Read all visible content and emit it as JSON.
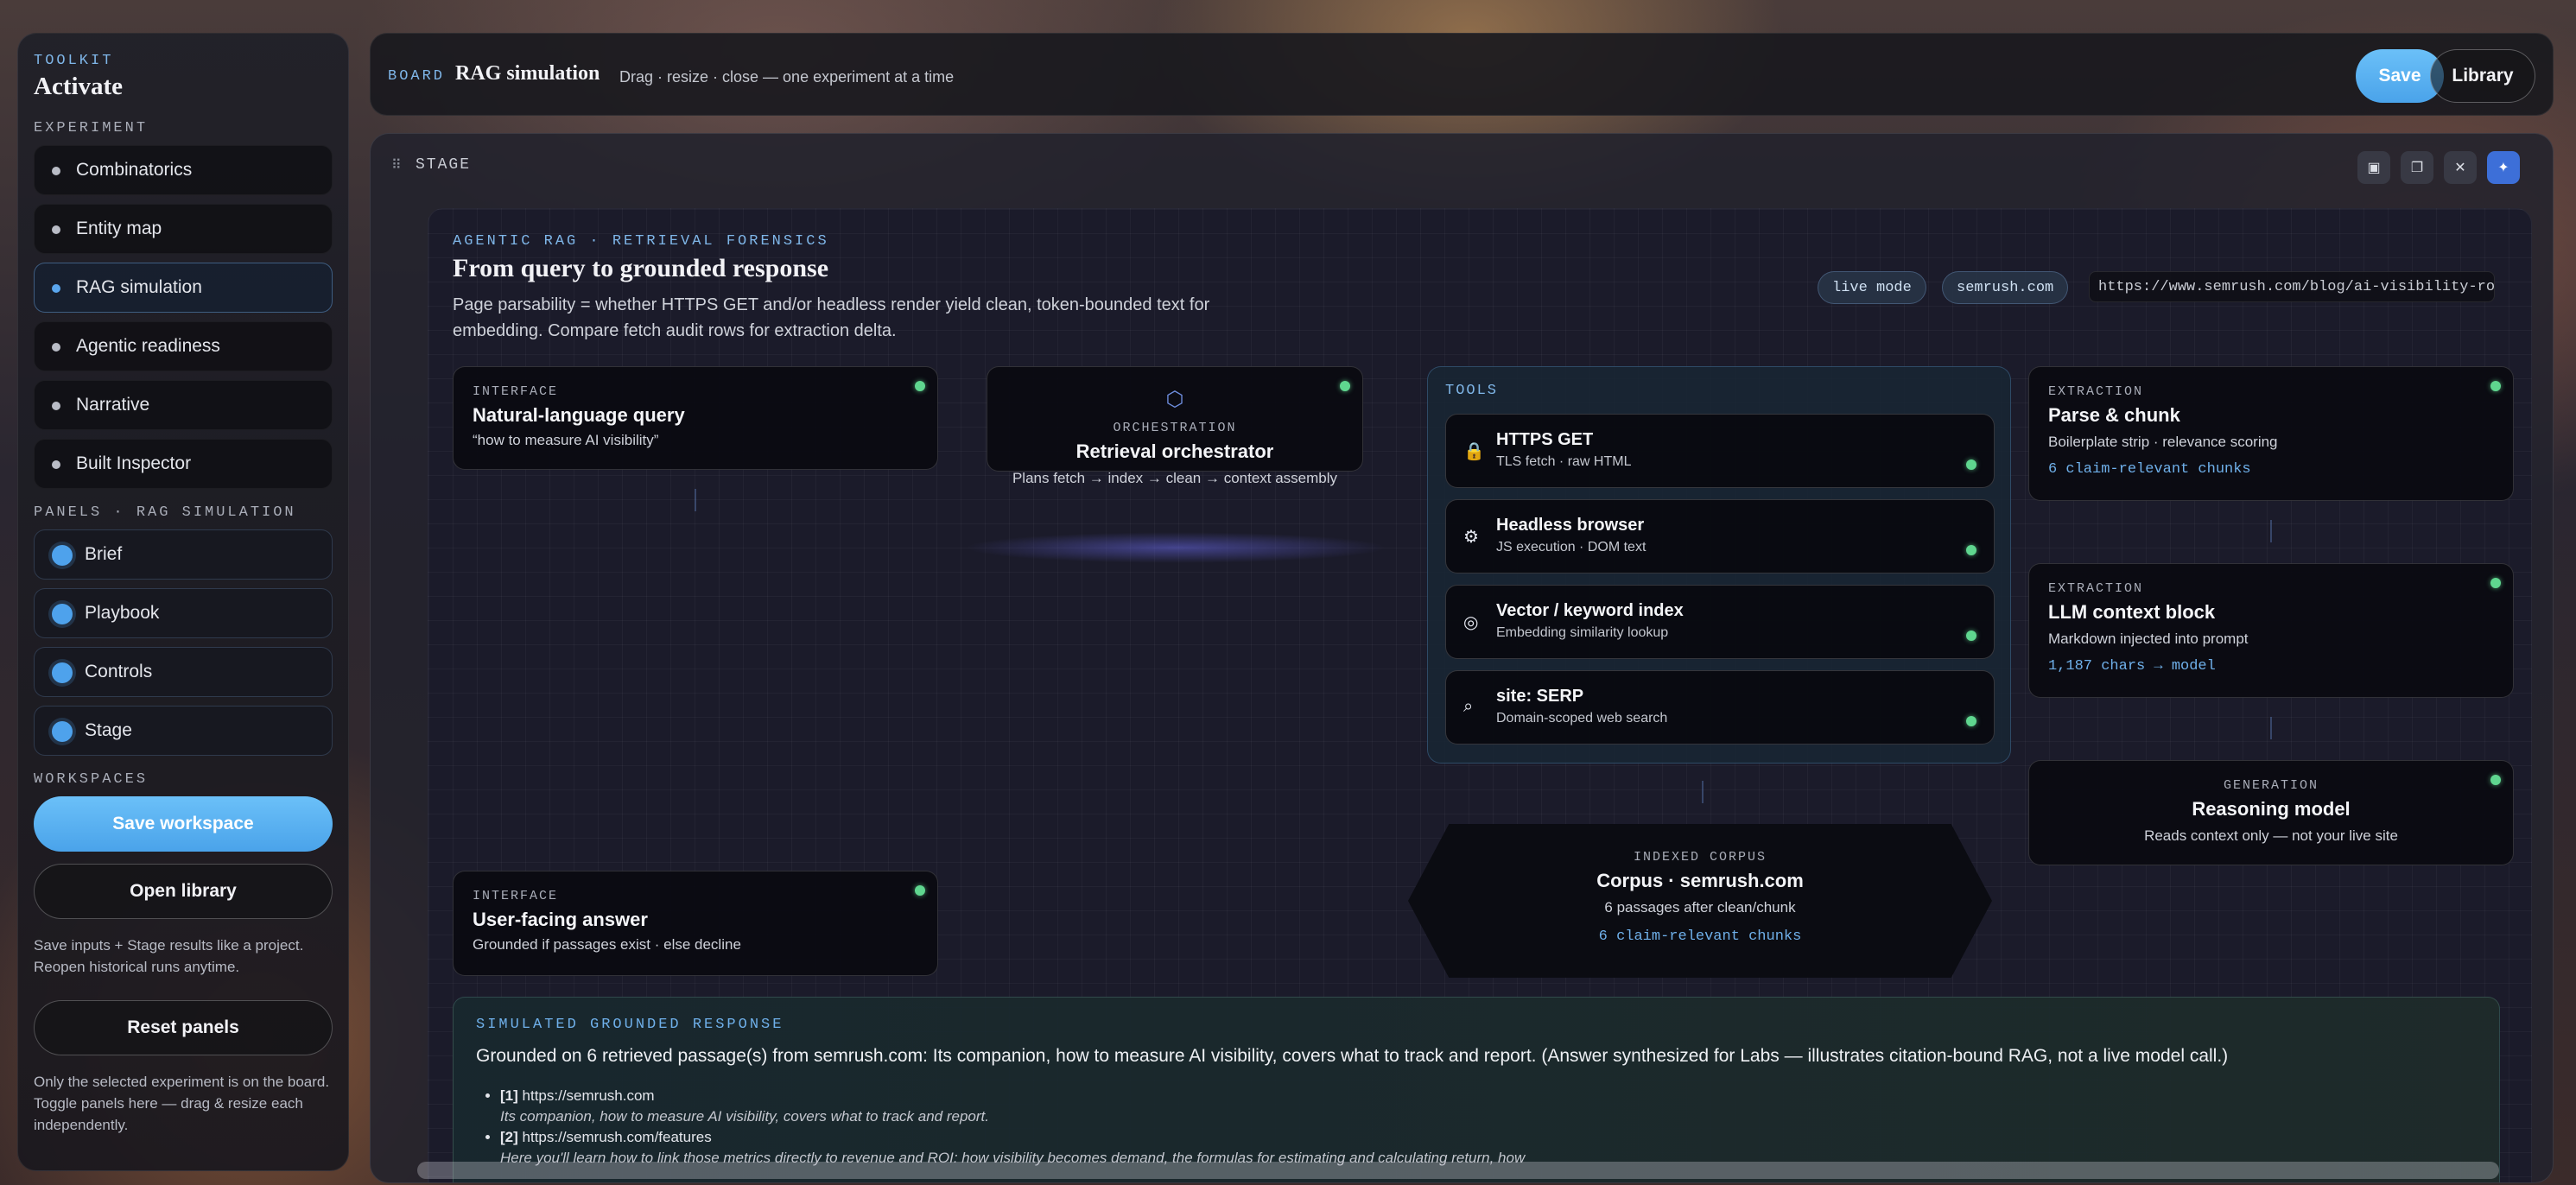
{
  "sidebar": {
    "kicker": "TOOLKIT",
    "title": "Activate",
    "experiment_heading": "EXPERIMENT",
    "experiments": [
      {
        "label": "Combinatorics"
      },
      {
        "label": "Entity map"
      },
      {
        "label": "RAG simulation",
        "active": true
      },
      {
        "label": "Agentic readiness"
      },
      {
        "label": "Narrative"
      },
      {
        "label": "Built Inspector"
      }
    ],
    "panels_heading": "PANELS · RAG SIMULATION",
    "panels": [
      {
        "label": "Brief"
      },
      {
        "label": "Playbook"
      },
      {
        "label": "Controls"
      },
      {
        "label": "Stage"
      }
    ],
    "workspaces_heading": "WORKSPACES",
    "save_workspace": "Save workspace",
    "open_library": "Open library",
    "workspace_note": "Save inputs + Stage results like a project. Reopen historical runs anytime.",
    "reset_panels": "Reset panels",
    "reset_note": "Only the selected experiment is on the board. Toggle panels here — drag & resize each independently."
  },
  "header": {
    "kicker": "BOARD",
    "title": "RAG simulation",
    "subtitle": "Drag · resize · close — one experiment at a time",
    "save": "Save",
    "library": "Library"
  },
  "stage": {
    "handle": "⠿",
    "label": "STAGE",
    "kicker": "AGENTIC RAG · RETRIEVAL FORENSICS",
    "title": "From query to grounded response",
    "subtitle": "Page parsability = whether HTTPS GET and/or headless render yield clean, token-bounded text for embedding. Compare fetch audit rows for extraction delta.",
    "mode_pill": "live mode",
    "domain_pill": "semrush.com",
    "url": "https://www.semrush.com/blog/ai-visibility-roi/",
    "query": {
      "kicker": "INTERFACE",
      "title": "Natural-language query",
      "sub": "“how to measure AI visibility”"
    },
    "orchestrator": {
      "kicker": "ORCHESTRATION",
      "title": "Retrieval orchestrator",
      "sub": "Plans fetch → index → clean → context assembly"
    },
    "tools_heading": "TOOLS",
    "tools": [
      {
        "icon": "lock-icon",
        "glyph": "🔒",
        "title": "HTTPS GET",
        "sub": "TLS fetch · raw HTML"
      },
      {
        "icon": "gear-icon",
        "glyph": "⚙",
        "title": "Headless browser",
        "sub": "JS execution · DOM text"
      },
      {
        "icon": "target-icon",
        "glyph": "◎",
        "title": "Vector / keyword index",
        "sub": "Embedding similarity lookup"
      },
      {
        "icon": "search-icon",
        "glyph": "⌕",
        "title": "site: SERP",
        "sub": "Domain-scoped web search"
      }
    ],
    "parse": {
      "kicker": "EXTRACTION",
      "title": "Parse & chunk",
      "sub": "Boilerplate strip · relevance scoring",
      "meta": "6 claim-relevant chunks"
    },
    "context": {
      "kicker": "EXTRACTION",
      "title": "LLM context block",
      "sub": "Markdown injected into prompt",
      "meta": "1,187 chars → model"
    },
    "reasoning": {
      "kicker": "GENERATION",
      "title": "Reasoning model",
      "sub": "Reads context only — not your live site"
    },
    "corpus": {
      "kicker": "INDEXED CORPUS",
      "title": "Corpus · semrush.com",
      "sub": "6 passages after clean/chunk",
      "meta": "6 claim-relevant chunks"
    },
    "answer": {
      "kicker": "INTERFACE",
      "title": "User-facing answer",
      "sub": "Grounded if passages exist · else decline"
    },
    "response": {
      "kicker": "SIMULATED GROUNDED RESPONSE",
      "text": "Grounded on 6 retrieved passage(s) from semrush.com: Its companion, how to measure AI visibility, covers what to track and report. (Answer synthesized for Labs — illustrates citation-bound RAG, not a live model call.)",
      "citations": [
        {
          "ref": "[1]",
          "url": "https://semrush.com",
          "quote": "Its companion, how to measure AI visibility, covers what to track and report."
        },
        {
          "ref": "[2]",
          "url": "https://semrush.com/features",
          "quote": "Here you'll learn how to link those metrics directly to revenue and ROI: how visibility becomes demand, the formulas for estimating and calculating return, how"
        }
      ]
    }
  }
}
